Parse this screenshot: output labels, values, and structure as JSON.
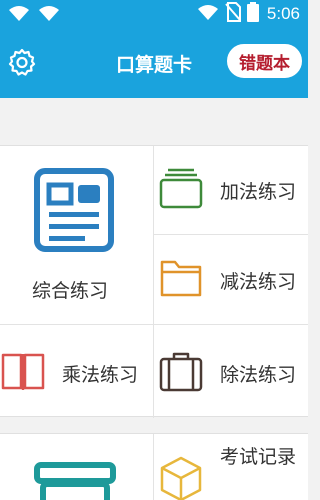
{
  "status": {
    "time": "5:06"
  },
  "header": {
    "title": "口算题卡",
    "wrong_book_label": "错题本"
  },
  "grid": {
    "comprehensive": "综合练习",
    "addition": "加法练习",
    "subtraction": "减法练习",
    "multiplication": "乘法练习",
    "division": "除法练习",
    "exam_record": "考试记录"
  },
  "colors": {
    "header_bg": "#1aa3dd",
    "wrong_book_text": "#b51e2f",
    "comprehensive_icon": "#2b7fc0",
    "addition_icon": "#3e8a3a",
    "subtraction_icon": "#e0932a",
    "multiplication_icon": "#d9534f",
    "division_icon": "#4a3a34",
    "exam_icon": "#e7b73c",
    "bottom_left_icon": "#1e9a9a"
  },
  "icons": {
    "settings": "gear-icon",
    "comprehensive": "form-card-icon",
    "addition": "stacked-box-icon",
    "subtraction": "folder-icon",
    "multiplication": "book-icon",
    "division": "suitcase-icon",
    "exam_record": "cube-icon"
  }
}
